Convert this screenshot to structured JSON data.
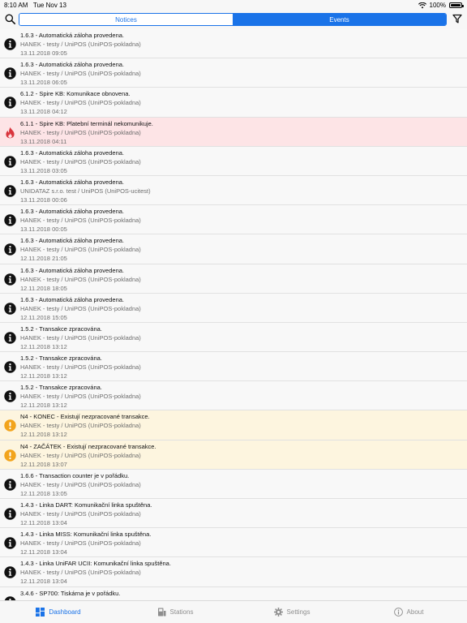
{
  "status_bar": {
    "time": "8:10 AM",
    "date": "Tue Nov 13",
    "battery": "100%",
    "battery_level": 1.0
  },
  "toolbar": {
    "search_icon": "search-icon",
    "filter_icon": "filter-icon"
  },
  "segments": [
    {
      "label": "Notices",
      "active": false
    },
    {
      "label": "Events",
      "active": true
    }
  ],
  "events": [
    {
      "title": "1.6.3 - Automatická záloha provedena.",
      "source": "HANEK - testy / UniPOS (UniPOS-pokladna)",
      "time": "13.11.2018 09:05",
      "level": "info"
    },
    {
      "title": "1.6.3 - Automatická záloha provedena.",
      "source": "HANEK - testy / UniPOS (UniPOS-pokladna)",
      "time": "13.11.2018 06:05",
      "level": "info"
    },
    {
      "title": "6.1.2 - Spire KB: Komunikace obnovena.",
      "source": "HANEK - testy / UniPOS (UniPOS-pokladna)",
      "time": "13.11.2018 04:12",
      "level": "info"
    },
    {
      "title": "6.1.1 - Spire KB: Platební terminál nekomunikuje.",
      "source": "HANEK - testy / UniPOS (UniPOS-pokladna)",
      "time": "13.11.2018 04:11",
      "level": "error"
    },
    {
      "title": "1.6.3 - Automatická záloha provedena.",
      "source": "HANEK - testy / UniPOS (UniPOS-pokladna)",
      "time": "13.11.2018 03:05",
      "level": "info"
    },
    {
      "title": "1.6.3 - Automatická záloha provedena.",
      "source": "UNIDATAZ s.r.o. test / UniPOS (UniPOS-ucitest)",
      "time": "13.11.2018 00:06",
      "level": "info"
    },
    {
      "title": "1.6.3 - Automatická záloha provedena.",
      "source": "HANEK - testy / UniPOS (UniPOS-pokladna)",
      "time": "13.11.2018 00:05",
      "level": "info"
    },
    {
      "title": "1.6.3 - Automatická záloha provedena.",
      "source": "HANEK - testy / UniPOS (UniPOS-pokladna)",
      "time": "12.11.2018 21:05",
      "level": "info"
    },
    {
      "title": "1.6.3 - Automatická záloha provedena.",
      "source": "HANEK - testy / UniPOS (UniPOS-pokladna)",
      "time": "12.11.2018 18:05",
      "level": "info"
    },
    {
      "title": "1.6.3 - Automatická záloha provedena.",
      "source": "HANEK - testy / UniPOS (UniPOS-pokladna)",
      "time": "12.11.2018 15:05",
      "level": "info"
    },
    {
      "title": "1.5.2 - Transakce zpracována.",
      "source": "HANEK - testy / UniPOS (UniPOS-pokladna)",
      "time": "12.11.2018 13:12",
      "level": "info"
    },
    {
      "title": "1.5.2 - Transakce zpracována.",
      "source": "HANEK - testy / UniPOS (UniPOS-pokladna)",
      "time": "12.11.2018 13:12",
      "level": "info"
    },
    {
      "title": "1.5.2 - Transakce zpracována.",
      "source": "HANEK - testy / UniPOS (UniPOS-pokladna)",
      "time": "12.11.2018 13:12",
      "level": "info"
    },
    {
      "title": "N4 - KONEC - Existují nezpracované transakce.",
      "source": "HANEK - testy / UniPOS (UniPOS-pokladna)",
      "time": "12.11.2018 13:12",
      "level": "warning"
    },
    {
      "title": "N4 - ZAČÁTEK - Existují nezpracované transakce.",
      "source": "HANEK - testy / UniPOS (UniPOS-pokladna)",
      "time": "12.11.2018 13:07",
      "level": "warning"
    },
    {
      "title": "1.6.6 - Transaction counter je v pořádku.",
      "source": "HANEK - testy / UniPOS (UniPOS-pokladna)",
      "time": "12.11.2018 13:05",
      "level": "info"
    },
    {
      "title": "1.4.3 - Linka DART: Komunikační linka spuštěna.",
      "source": "HANEK - testy / UniPOS (UniPOS-pokladna)",
      "time": "12.11.2018 13:04",
      "level": "info"
    },
    {
      "title": "1.4.3 - Linka MISS: Komunikační linka spuštěna.",
      "source": "HANEK - testy / UniPOS (UniPOS-pokladna)",
      "time": "12.11.2018 13:04",
      "level": "info"
    },
    {
      "title": "1.4.3 - Linka UniFAR UCII: Komunikační linka spuštěna.",
      "source": "HANEK - testy / UniPOS (UniPOS-pokladna)",
      "time": "12.11.2018 13:04",
      "level": "info"
    },
    {
      "title": "3.4.6 - SP700: Tiskárna je v pořádku.",
      "source": "",
      "time": "",
      "level": "info"
    }
  ],
  "tabs": [
    {
      "label": "Dashboard",
      "icon": "dashboard-icon",
      "active": true
    },
    {
      "label": "Stations",
      "icon": "stations-icon",
      "active": false
    },
    {
      "label": "Settings",
      "icon": "gear-icon",
      "active": false
    },
    {
      "label": "About",
      "icon": "info-circle-icon",
      "active": false
    }
  ],
  "colors": {
    "accent": "#1a73e8",
    "info": "#111111",
    "warning": "#f2a41c",
    "error": "#d9363e",
    "error_row": "#fde4e6",
    "warning_row": "#fdf5df"
  }
}
